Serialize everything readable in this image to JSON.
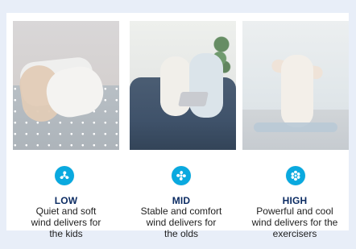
{
  "modes": [
    {
      "label": "LOW",
      "description": "Quiet and soft\nwind delivers for\nthe kids",
      "icon": "fan-icon"
    },
    {
      "label": "MID",
      "description": "Stable and comfort\nwind delivers for\nthe olds",
      "icon": "fan-icon"
    },
    {
      "label": "HIGH",
      "description": "Powerful and cool\nwind delivers for the\nexercisers",
      "icon": "fan-icon"
    }
  ],
  "colors": {
    "accent": "#0aa9df",
    "label": "#0c2c63",
    "background": "#e8eef8"
  }
}
